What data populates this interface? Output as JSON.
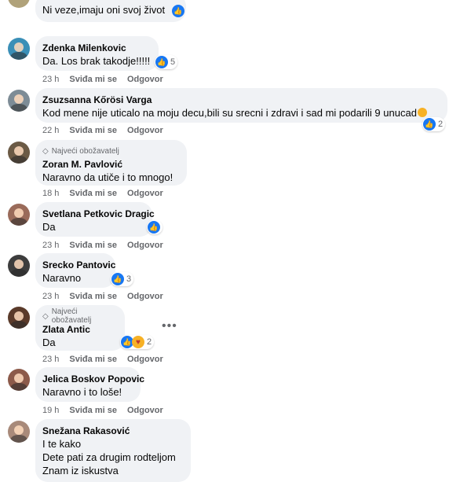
{
  "comments": [
    {
      "text": "Ni veze,imaju oni svoj život",
      "reaction_count": ""
    },
    {
      "author": "Zdenka Milenkovic",
      "text": "Da. Los brak takodje!!!!!",
      "reaction_count": "5",
      "time": "23 h",
      "like": "Sviđa mi se",
      "reply": "Odgovor"
    },
    {
      "author": "Zsuzsanna Kőrösi Varga",
      "text": "Kod mene nije uticalo na moju decu,bili su srecni i zdravi i sad mi podarili 9 unucad",
      "reaction_count": "2",
      "time": "22 h",
      "like": "Sviđa mi se",
      "reply": "Odgovor"
    },
    {
      "badge": "Najveći obožavatelj",
      "author": "Zoran M. Pavlović",
      "text": "Naravno da utiče i to mnogo!",
      "time": "18 h",
      "like": "Sviđa mi se",
      "reply": "Odgovor"
    },
    {
      "author": "Svetlana Petkovic Dragic",
      "text": "Da",
      "reaction_count": "",
      "time": "23 h",
      "like": "Sviđa mi se",
      "reply": "Odgovor"
    },
    {
      "author": "Srecko Pantovic",
      "text": "Naravno",
      "reaction_count": "3",
      "time": "23 h",
      "like": "Sviđa mi se",
      "reply": "Odgovor"
    },
    {
      "badge": "Najveći obožavatelj",
      "author": "Zlata Antic",
      "text": "Da",
      "reaction_count": "2",
      "time": "23 h",
      "like": "Sviđa mi se",
      "reply": "Odgovor",
      "more": "•••"
    },
    {
      "author": "Jelica Boskov Popovic",
      "text": "Naravno i to loše!",
      "time": "19 h",
      "like": "Sviđa mi se",
      "reply": "Odgovor"
    },
    {
      "author": "Snežana Rakasović",
      "lines": [
        "I te kako",
        "Dete pati za drugim rodteljom",
        "Znam iz iskustva"
      ]
    }
  ],
  "icons": {
    "like": "like-icon",
    "care": "care-icon",
    "badge": "diamond-icon",
    "more": "more-options-icon"
  },
  "colors": {
    "accent": "#1877f2",
    "bubble": "#f0f2f5",
    "meta": "#65676b"
  }
}
